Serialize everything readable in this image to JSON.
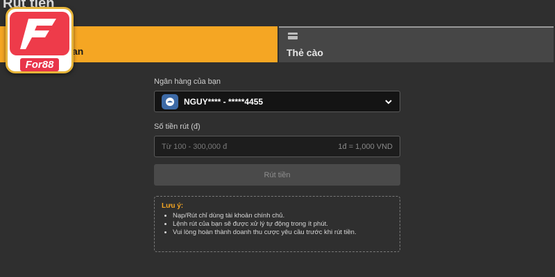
{
  "page": {
    "title": "Rút tiền"
  },
  "logo": {
    "text": "For88"
  },
  "tabs": [
    {
      "label": "an",
      "active": true
    },
    {
      "label": "Thẻ cào",
      "active": false,
      "icon": "card-icon"
    }
  ],
  "form": {
    "bank_label": "Ngân hàng của bạn",
    "bank_value": "NGUY**** - *****4455",
    "bank_icon": "bank-icon",
    "amount_label": "Số tiền rút (đ)",
    "amount_placeholder": "Từ 100 - 300,000 đ",
    "rate": "1đ = 1,000 VND",
    "submit_label": "Rút tiền"
  },
  "note": {
    "title": "Lưu ý:",
    "items": [
      "Nạp/Rút chỉ dùng tài khoản chính chủ.",
      "Lệnh rút của bạn sẽ được xử lý tự động trong ít phút.",
      "Vui lòng hoàn thành doanh thu cược yêu cầu trước khi rút tiền."
    ]
  },
  "colors": {
    "accent": "#f5a623",
    "background": "#2f2f2f",
    "logo_red": "#ee3b4a"
  }
}
